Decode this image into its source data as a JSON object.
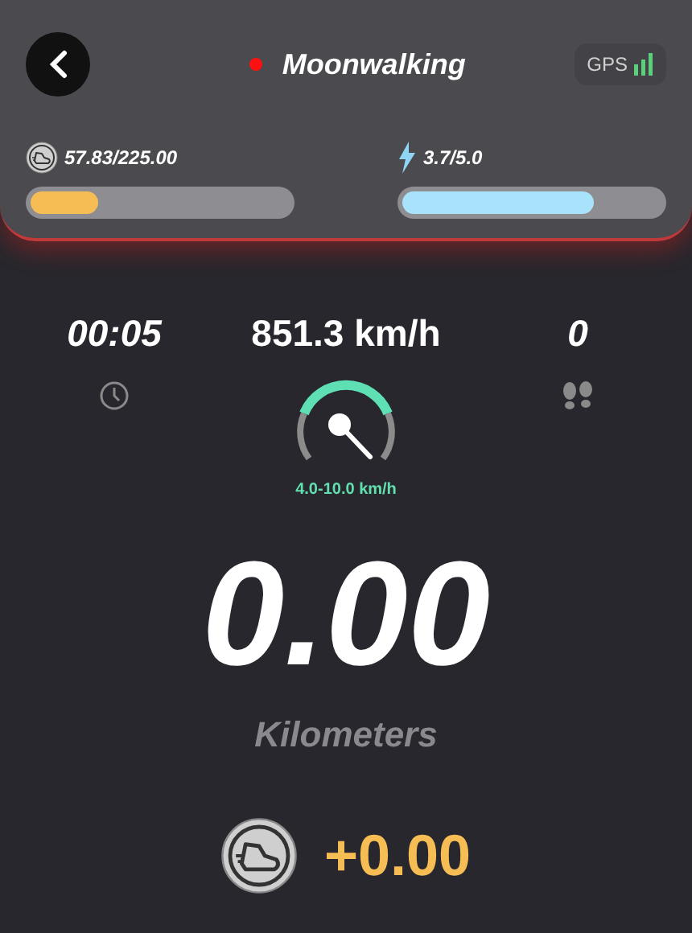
{
  "header": {
    "title": "Moonwalking",
    "recording": true,
    "gps_label": "GPS"
  },
  "meters": [
    {
      "kind": "shoe",
      "reading": "57.83/225.00",
      "level": 0.26
    },
    {
      "kind": "energy",
      "reading": "3.7/5.0",
      "level": 0.74
    }
  ],
  "stats": {
    "time": "00:05",
    "speed": "851.3 km/h",
    "steps": "0",
    "speed_range": "4.0-10.0 km/h"
  },
  "distance": {
    "value": "0.00",
    "unit": "Kilometers"
  },
  "reward": "+0.00"
}
